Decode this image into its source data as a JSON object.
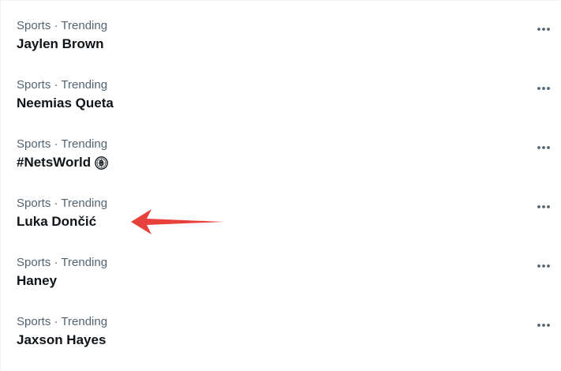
{
  "trends": [
    {
      "context": "Sports · Trending",
      "title": "Jaylen Brown",
      "more_icon": "ellipsis-icon"
    },
    {
      "context": "Sports · Trending",
      "title": "Neemias Queta",
      "more_icon": "ellipsis-icon"
    },
    {
      "context": "Sports · Trending",
      "title": "#NetsWorld",
      "hashflag": "brooklyn-nets-logo-icon",
      "more_icon": "ellipsis-icon"
    },
    {
      "context": "Sports · Trending",
      "title": "Luka Dončić",
      "more_icon": "ellipsis-icon"
    },
    {
      "context": "Sports · Trending",
      "title": "Haney",
      "more_icon": "ellipsis-icon"
    },
    {
      "context": "Sports · Trending",
      "title": "Jaxson Hayes",
      "more_icon": "ellipsis-icon"
    }
  ],
  "annotation": {
    "type": "arrow",
    "color": "#e8413b",
    "points_to": "Luka Dončić"
  },
  "colors": {
    "context_text": "#536471",
    "title_text": "#0f1419",
    "divider": "#eff3f4"
  }
}
